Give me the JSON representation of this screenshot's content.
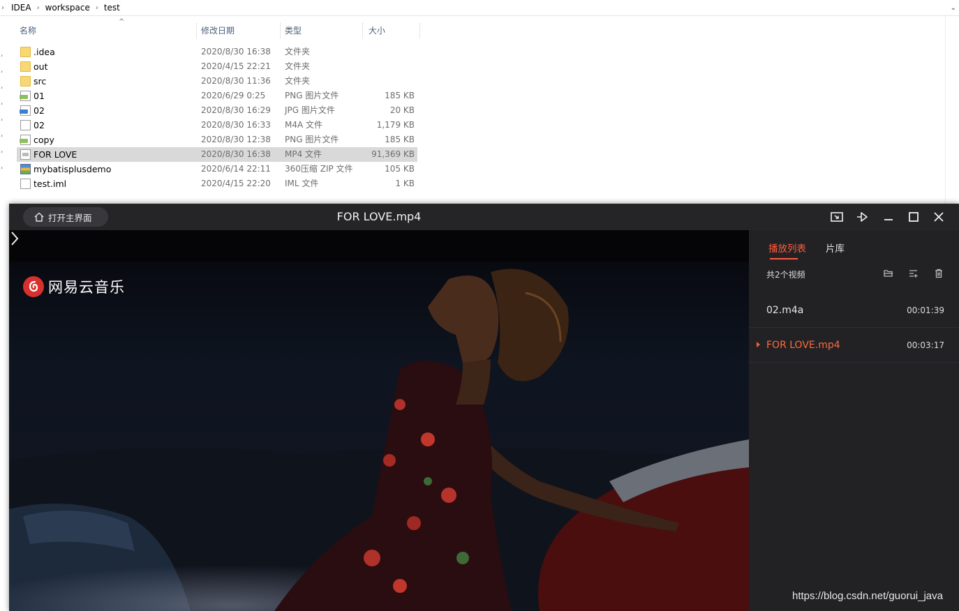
{
  "explorer": {
    "breadcrumbs": [
      "IDEA",
      "workspace",
      "test"
    ],
    "columns": {
      "name": "名称",
      "date": "修改日期",
      "type": "类型",
      "size": "大小"
    },
    "files": [
      {
        "name": ".idea",
        "date": "2020/8/30 16:38",
        "type": "文件夹",
        "size": "",
        "icon": "folder-icon"
      },
      {
        "name": "out",
        "date": "2020/4/15 22:21",
        "type": "文件夹",
        "size": "",
        "icon": "folder-icon"
      },
      {
        "name": "src",
        "date": "2020/8/30 11:36",
        "type": "文件夹",
        "size": "",
        "icon": "folder-icon"
      },
      {
        "name": "01",
        "date": "2020/6/29 0:25",
        "type": "PNG 图片文件",
        "size": "185 KB",
        "icon": "png-file-icon"
      },
      {
        "name": "02",
        "date": "2020/8/30 16:29",
        "type": "JPG 图片文件",
        "size": "20 KB",
        "icon": "jpg-file-icon"
      },
      {
        "name": "02",
        "date": "2020/8/30 16:33",
        "type": "M4A 文件",
        "size": "1,179 KB",
        "icon": "file-icon"
      },
      {
        "name": "copy",
        "date": "2020/8/30 12:38",
        "type": "PNG 图片文件",
        "size": "185 KB",
        "icon": "png-file-icon"
      },
      {
        "name": "FOR LOVE",
        "date": "2020/8/30 16:38",
        "type": "MP4 文件",
        "size": "91,369 KB",
        "icon": "mp4-file-icon",
        "selected": true
      },
      {
        "name": "mybatisplusdemo",
        "date": "2020/6/14 22:11",
        "type": "360压缩 ZIP 文件",
        "size": "105 KB",
        "icon": "zip-file-icon"
      },
      {
        "name": "test.iml",
        "date": "2020/4/15 22:20",
        "type": "IML 文件",
        "size": "1 KB",
        "icon": "file-icon"
      }
    ]
  },
  "player": {
    "home_label": "打开主界面",
    "title": "FOR LOVE.mp4",
    "logo_text": "网易云音乐",
    "tabs": {
      "playlist": "播放列表",
      "library": "片库"
    },
    "count_label": "共2个视频",
    "items": [
      {
        "name": "02.m4a",
        "duration": "00:01:39",
        "playing": false
      },
      {
        "name": "FOR LOVE.mp4",
        "duration": "00:03:17",
        "playing": true
      }
    ],
    "accent_color": "#ff5a3c"
  },
  "watermark": "https://blog.csdn.net/guorui_java"
}
